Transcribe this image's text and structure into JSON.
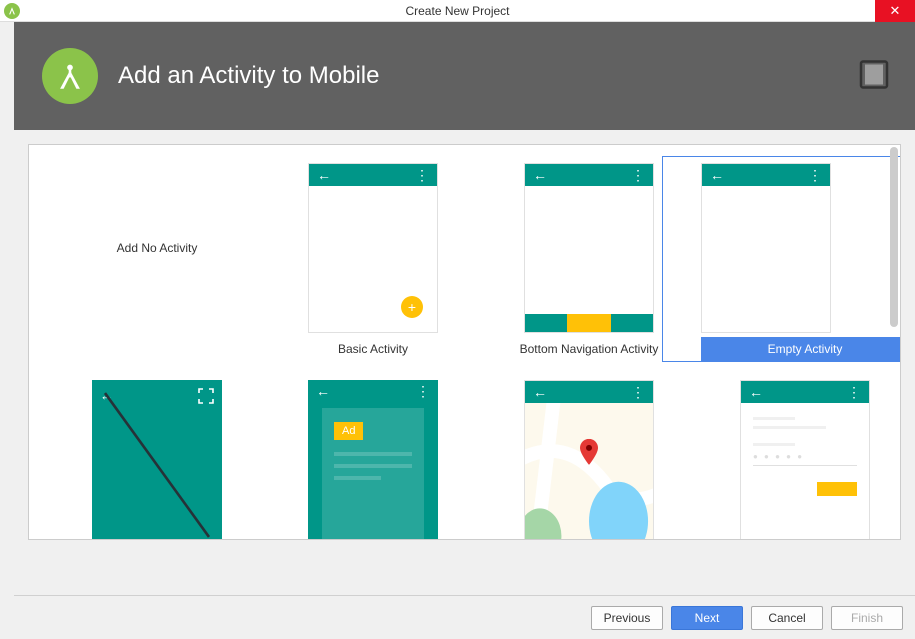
{
  "window": {
    "title": "Create New Project"
  },
  "header": {
    "title": "Add an Activity to Mobile"
  },
  "templates": [
    {
      "id": "no-activity",
      "label": "Add No Activity",
      "thumb": "none",
      "selected": false
    },
    {
      "id": "basic",
      "label": "Basic Activity",
      "thumb": "basic",
      "selected": false
    },
    {
      "id": "bottom-nav",
      "label": "Bottom Navigation Activity",
      "thumb": "bottomnav",
      "selected": false
    },
    {
      "id": "empty",
      "label": "Empty Activity",
      "thumb": "empty",
      "selected": true
    },
    {
      "id": "fullscreen",
      "label": "",
      "thumb": "fullscreen",
      "selected": false
    },
    {
      "id": "admob",
      "label": "",
      "thumb": "admob",
      "selected": false
    },
    {
      "id": "maps",
      "label": "",
      "thumb": "map",
      "selected": false
    },
    {
      "id": "login",
      "label": "",
      "thumb": "login",
      "selected": false
    }
  ],
  "buttons": {
    "previous": "Previous",
    "next": "Next",
    "cancel": "Cancel",
    "finish": "Finish"
  },
  "colors": {
    "accent": "#4a86e8",
    "brand_green": "#8bc34a",
    "teal": "#009688",
    "amber": "#ffc107",
    "header_bg": "#616161"
  }
}
